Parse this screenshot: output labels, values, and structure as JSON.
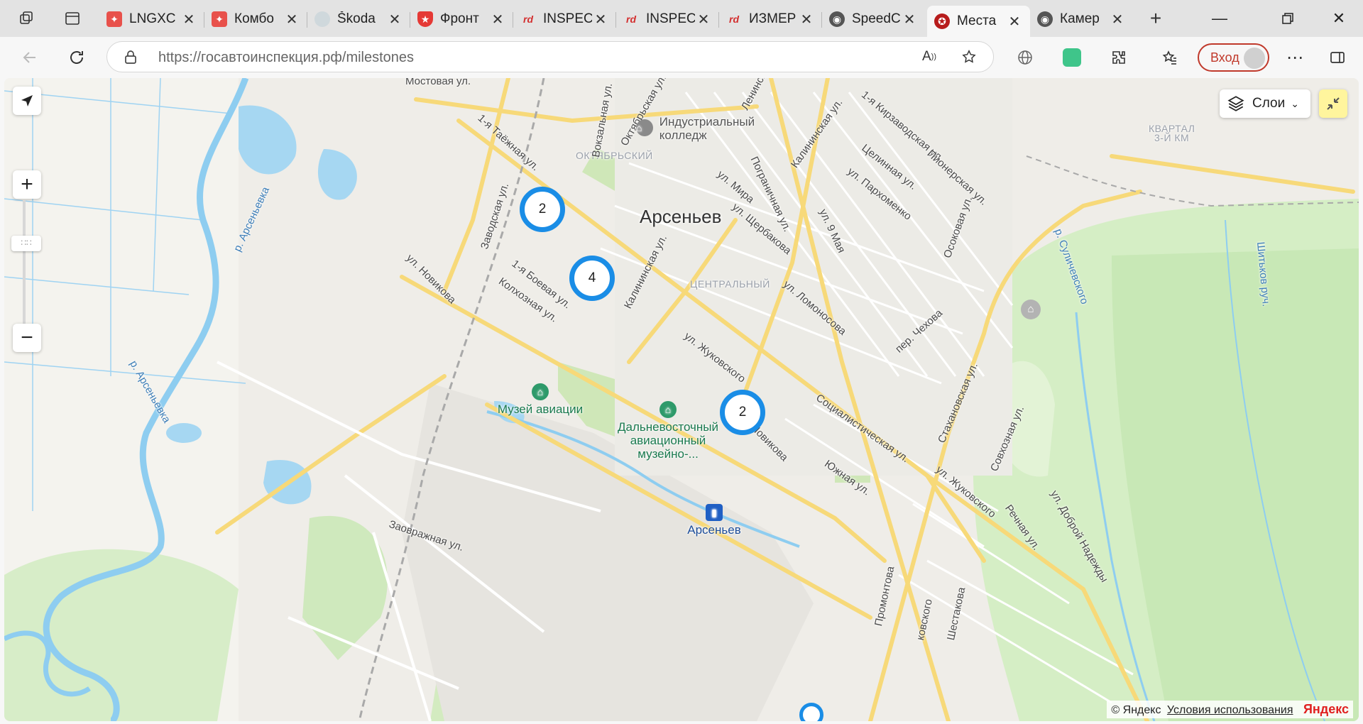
{
  "browser": {
    "tabs": [
      {
        "title": "LNGXC",
        "favicon": "red-star-icon",
        "active": false
      },
      {
        "title": "Комбо",
        "favicon": "red-star-icon",
        "active": false
      },
      {
        "title": "Škoda",
        "favicon": "skoda-icon",
        "active": false
      },
      {
        "title": "Фронт",
        "favicon": "red-shield-icon",
        "active": false
      },
      {
        "title": "INSPEC",
        "favicon": "inspec-icon",
        "active": false
      },
      {
        "title": "INSPEC",
        "favicon": "inspec-icon",
        "active": false
      },
      {
        "title": "ИЗМЕР",
        "favicon": "inspec-icon",
        "active": false
      },
      {
        "title": "SpeedC",
        "favicon": "camera-icon",
        "active": false
      },
      {
        "title": "Места",
        "favicon": "police-emblem-icon",
        "active": true
      },
      {
        "title": "Камер",
        "favicon": "camera-icon",
        "active": false
      }
    ],
    "url_host": "https://госавтоинспекция.рф",
    "url_path": "/milestones",
    "login_label": "Вход"
  },
  "map": {
    "city_label": "Арсеньев",
    "layers_label": "Слои",
    "districts": [
      "ОКТЯБРЬСКИЙ",
      "ЦЕНТРАЛЬНЫЙ",
      "КВАРТАЛ",
      "3-Й КМ"
    ],
    "streets": [
      "Мостовая ул.",
      "Вокзальная ул.",
      "Октябрьская ул.",
      "Ленинская ул.",
      "Калининская ул.",
      "1-я Кирзаводская ул.",
      "1-я Таёжная ул.",
      "Целинная ул.",
      "Пионерская ул.",
      "ул. Пархоменко",
      "Пограничная ул.",
      "ул. Мира",
      "ул. Щербакова",
      "ул. 9 Мая",
      "Осоковая ул.",
      "Заводская ул.",
      "ул. Новикова",
      "1-я Боевая ул.",
      "Колхозная ул.",
      "Калининская ул.",
      "ул. Ломоносова",
      "пер. Чехова",
      "ул. Жуковского",
      "Социалистическая ул.",
      "Стахановская ул.",
      "Совхозная ул.",
      "Южная ул.",
      "ул. Жуковского",
      "Речная ул.",
      "ул. Доброй Надежды",
      "Заовражная ул.",
      "Новикова",
      "Промонтова",
      "ковского",
      "Шестакова"
    ],
    "rivers": [
      "р. Арсеньевка",
      "р. Арсеньевка",
      "р. Суличевского",
      "Шитьков руч."
    ],
    "pois": [
      {
        "name": "Индустриальный колледж",
        "icon": "college-icon"
      },
      {
        "name": "Музей авиации",
        "icon": "museum-icon"
      },
      {
        "name": "Дальневосточный авиационный музейно-...",
        "icon": "museum-icon"
      },
      {
        "name": "Арсеньев",
        "icon": "railway-station-icon"
      }
    ],
    "clusters": [
      "2",
      "4",
      "2"
    ],
    "copyright": "© Яндекс",
    "terms": "Условия использования",
    "brand": "Яндекс"
  }
}
